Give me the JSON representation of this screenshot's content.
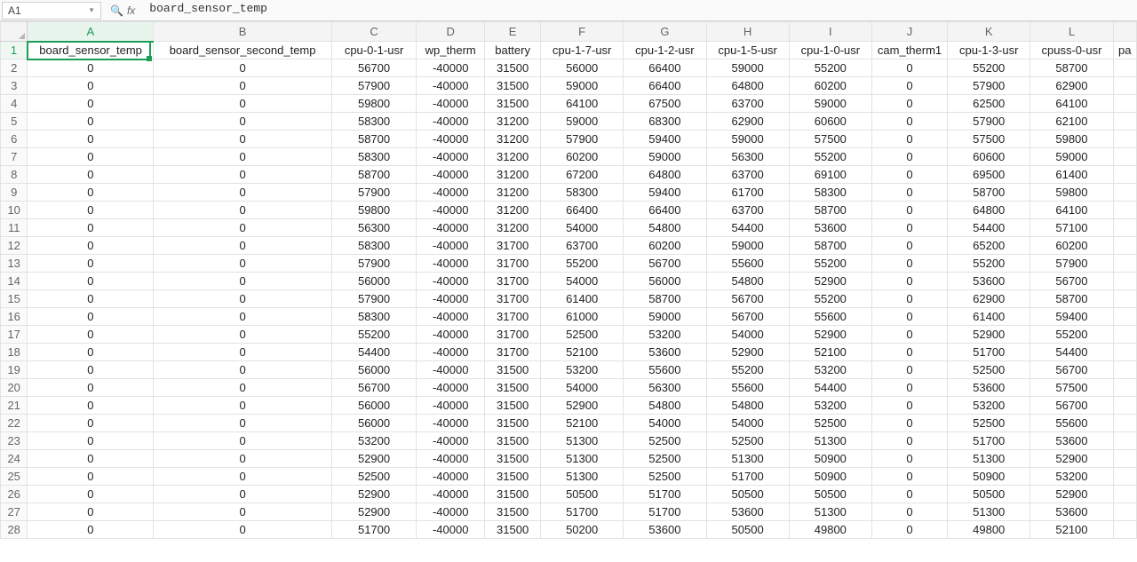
{
  "formula_bar": {
    "cell_ref": "A1",
    "fx_label": "fx",
    "formula_text": "board_sensor_temp"
  },
  "columns": [
    "A",
    "B",
    "C",
    "D",
    "E",
    "F",
    "G",
    "H",
    "I",
    "J",
    "K",
    "L"
  ],
  "extra_col_partial": "pa",
  "headers": {
    "A": "board_sensor_temp",
    "B": "board_sensor_second_temp",
    "C": "cpu-0-1-usr",
    "D": "wp_therm",
    "E": "battery",
    "F": "cpu-1-7-usr",
    "G": "cpu-1-2-usr",
    "H": "cpu-1-5-usr",
    "I": "cpu-1-0-usr",
    "J": "cam_therm1",
    "K": "cpu-1-3-usr",
    "L": "cpuss-0-usr"
  },
  "rows": [
    {
      "n": 2,
      "A": "0",
      "B": "0",
      "C": "56700",
      "D": "-40000",
      "E": "31500",
      "F": "56000",
      "G": "66400",
      "H": "59000",
      "I": "55200",
      "J": "0",
      "K": "55200",
      "L": "58700"
    },
    {
      "n": 3,
      "A": "0",
      "B": "0",
      "C": "57900",
      "D": "-40000",
      "E": "31500",
      "F": "59000",
      "G": "66400",
      "H": "64800",
      "I": "60200",
      "J": "0",
      "K": "57900",
      "L": "62900"
    },
    {
      "n": 4,
      "A": "0",
      "B": "0",
      "C": "59800",
      "D": "-40000",
      "E": "31500",
      "F": "64100",
      "G": "67500",
      "H": "63700",
      "I": "59000",
      "J": "0",
      "K": "62500",
      "L": "64100"
    },
    {
      "n": 5,
      "A": "0",
      "B": "0",
      "C": "58300",
      "D": "-40000",
      "E": "31200",
      "F": "59000",
      "G": "68300",
      "H": "62900",
      "I": "60600",
      "J": "0",
      "K": "57900",
      "L": "62100"
    },
    {
      "n": 6,
      "A": "0",
      "B": "0",
      "C": "58700",
      "D": "-40000",
      "E": "31200",
      "F": "57900",
      "G": "59400",
      "H": "59000",
      "I": "57500",
      "J": "0",
      "K": "57500",
      "L": "59800"
    },
    {
      "n": 7,
      "A": "0",
      "B": "0",
      "C": "58300",
      "D": "-40000",
      "E": "31200",
      "F": "60200",
      "G": "59000",
      "H": "56300",
      "I": "55200",
      "J": "0",
      "K": "60600",
      "L": "59000"
    },
    {
      "n": 8,
      "A": "0",
      "B": "0",
      "C": "58700",
      "D": "-40000",
      "E": "31200",
      "F": "67200",
      "G": "64800",
      "H": "63700",
      "I": "69100",
      "J": "0",
      "K": "69500",
      "L": "61400"
    },
    {
      "n": 9,
      "A": "0",
      "B": "0",
      "C": "57900",
      "D": "-40000",
      "E": "31200",
      "F": "58300",
      "G": "59400",
      "H": "61700",
      "I": "58300",
      "J": "0",
      "K": "58700",
      "L": "59800"
    },
    {
      "n": 10,
      "A": "0",
      "B": "0",
      "C": "59800",
      "D": "-40000",
      "E": "31200",
      "F": "66400",
      "G": "66400",
      "H": "63700",
      "I": "58700",
      "J": "0",
      "K": "64800",
      "L": "64100"
    },
    {
      "n": 11,
      "A": "0",
      "B": "0",
      "C": "56300",
      "D": "-40000",
      "E": "31200",
      "F": "54000",
      "G": "54800",
      "H": "54400",
      "I": "53600",
      "J": "0",
      "K": "54400",
      "L": "57100"
    },
    {
      "n": 12,
      "A": "0",
      "B": "0",
      "C": "58300",
      "D": "-40000",
      "E": "31700",
      "F": "63700",
      "G": "60200",
      "H": "59000",
      "I": "58700",
      "J": "0",
      "K": "65200",
      "L": "60200"
    },
    {
      "n": 13,
      "A": "0",
      "B": "0",
      "C": "57900",
      "D": "-40000",
      "E": "31700",
      "F": "55200",
      "G": "56700",
      "H": "55600",
      "I": "55200",
      "J": "0",
      "K": "55200",
      "L": "57900"
    },
    {
      "n": 14,
      "A": "0",
      "B": "0",
      "C": "56000",
      "D": "-40000",
      "E": "31700",
      "F": "54000",
      "G": "56000",
      "H": "54800",
      "I": "52900",
      "J": "0",
      "K": "53600",
      "L": "56700"
    },
    {
      "n": 15,
      "A": "0",
      "B": "0",
      "C": "57900",
      "D": "-40000",
      "E": "31700",
      "F": "61400",
      "G": "58700",
      "H": "56700",
      "I": "55200",
      "J": "0",
      "K": "62900",
      "L": "58700"
    },
    {
      "n": 16,
      "A": "0",
      "B": "0",
      "C": "58300",
      "D": "-40000",
      "E": "31700",
      "F": "61000",
      "G": "59000",
      "H": "56700",
      "I": "55600",
      "J": "0",
      "K": "61400",
      "L": "59400"
    },
    {
      "n": 17,
      "A": "0",
      "B": "0",
      "C": "55200",
      "D": "-40000",
      "E": "31700",
      "F": "52500",
      "G": "53200",
      "H": "54000",
      "I": "52900",
      "J": "0",
      "K": "52900",
      "L": "55200"
    },
    {
      "n": 18,
      "A": "0",
      "B": "0",
      "C": "54400",
      "D": "-40000",
      "E": "31700",
      "F": "52100",
      "G": "53600",
      "H": "52900",
      "I": "52100",
      "J": "0",
      "K": "51700",
      "L": "54400"
    },
    {
      "n": 19,
      "A": "0",
      "B": "0",
      "C": "56000",
      "D": "-40000",
      "E": "31500",
      "F": "53200",
      "G": "55600",
      "H": "55200",
      "I": "53200",
      "J": "0",
      "K": "52500",
      "L": "56700"
    },
    {
      "n": 20,
      "A": "0",
      "B": "0",
      "C": "56700",
      "D": "-40000",
      "E": "31500",
      "F": "54000",
      "G": "56300",
      "H": "55600",
      "I": "54400",
      "J": "0",
      "K": "53600",
      "L": "57500"
    },
    {
      "n": 21,
      "A": "0",
      "B": "0",
      "C": "56000",
      "D": "-40000",
      "E": "31500",
      "F": "52900",
      "G": "54800",
      "H": "54800",
      "I": "53200",
      "J": "0",
      "K": "53200",
      "L": "56700"
    },
    {
      "n": 22,
      "A": "0",
      "B": "0",
      "C": "56000",
      "D": "-40000",
      "E": "31500",
      "F": "52100",
      "G": "54000",
      "H": "54000",
      "I": "52500",
      "J": "0",
      "K": "52500",
      "L": "55600"
    },
    {
      "n": 23,
      "A": "0",
      "B": "0",
      "C": "53200",
      "D": "-40000",
      "E": "31500",
      "F": "51300",
      "G": "52500",
      "H": "52500",
      "I": "51300",
      "J": "0",
      "K": "51700",
      "L": "53600"
    },
    {
      "n": 24,
      "A": "0",
      "B": "0",
      "C": "52900",
      "D": "-40000",
      "E": "31500",
      "F": "51300",
      "G": "52500",
      "H": "51300",
      "I": "50900",
      "J": "0",
      "K": "51300",
      "L": "52900"
    },
    {
      "n": 25,
      "A": "0",
      "B": "0",
      "C": "52500",
      "D": "-40000",
      "E": "31500",
      "F": "51300",
      "G": "52500",
      "H": "51700",
      "I": "50900",
      "J": "0",
      "K": "50900",
      "L": "53200"
    },
    {
      "n": 26,
      "A": "0",
      "B": "0",
      "C": "52900",
      "D": "-40000",
      "E": "31500",
      "F": "50500",
      "G": "51700",
      "H": "50500",
      "I": "50500",
      "J": "0",
      "K": "50500",
      "L": "52900"
    },
    {
      "n": 27,
      "A": "0",
      "B": "0",
      "C": "52900",
      "D": "-40000",
      "E": "31500",
      "F": "51700",
      "G": "51700",
      "H": "53600",
      "I": "51300",
      "J": "0",
      "K": "51300",
      "L": "53600"
    },
    {
      "n": 28,
      "A": "0",
      "B": "0",
      "C": "51700",
      "D": "-40000",
      "E": "31500",
      "F": "50200",
      "G": "53600",
      "H": "50500",
      "I": "49800",
      "J": "0",
      "K": "49800",
      "L": "52100"
    }
  ]
}
